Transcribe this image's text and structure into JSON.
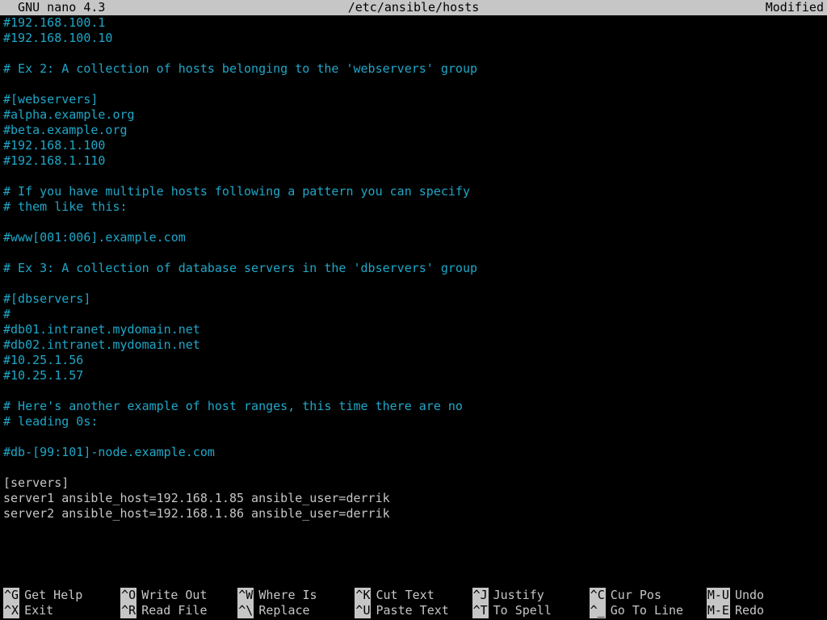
{
  "titlebar": {
    "app": "  GNU nano 4.3",
    "file": "/etc/ansible/hosts",
    "status": "Modified"
  },
  "lines": [
    {
      "type": "comment",
      "text": "#192.168.100.1"
    },
    {
      "type": "comment",
      "text": "#192.168.100.10"
    },
    {
      "type": "comment",
      "text": ""
    },
    {
      "type": "comment",
      "text": "# Ex 2: A collection of hosts belonging to the 'webservers' group"
    },
    {
      "type": "comment",
      "text": ""
    },
    {
      "type": "comment",
      "text": "#[webservers]"
    },
    {
      "type": "comment",
      "text": "#alpha.example.org"
    },
    {
      "type": "comment",
      "text": "#beta.example.org"
    },
    {
      "type": "comment",
      "text": "#192.168.1.100"
    },
    {
      "type": "comment",
      "text": "#192.168.1.110"
    },
    {
      "type": "comment",
      "text": ""
    },
    {
      "type": "comment",
      "text": "# If you have multiple hosts following a pattern you can specify"
    },
    {
      "type": "comment",
      "text": "# them like this:"
    },
    {
      "type": "comment",
      "text": ""
    },
    {
      "type": "comment",
      "text": "#www[001:006].example.com"
    },
    {
      "type": "comment",
      "text": ""
    },
    {
      "type": "comment",
      "text": "# Ex 3: A collection of database servers in the 'dbservers' group"
    },
    {
      "type": "comment",
      "text": ""
    },
    {
      "type": "comment",
      "text": "#[dbservers]"
    },
    {
      "type": "comment",
      "text": "#"
    },
    {
      "type": "comment",
      "text": "#db01.intranet.mydomain.net"
    },
    {
      "type": "comment",
      "text": "#db02.intranet.mydomain.net"
    },
    {
      "type": "comment",
      "text": "#10.25.1.56"
    },
    {
      "type": "comment",
      "text": "#10.25.1.57"
    },
    {
      "type": "comment",
      "text": ""
    },
    {
      "type": "comment",
      "text": "# Here's another example of host ranges, this time there are no"
    },
    {
      "type": "comment",
      "text": "# leading 0s:"
    },
    {
      "type": "comment",
      "text": ""
    },
    {
      "type": "comment",
      "text": "#db-[99:101]-node.example.com"
    },
    {
      "type": "plain",
      "text": ""
    },
    {
      "type": "plain",
      "text": "[servers]"
    },
    {
      "type": "plain",
      "text": "server1 ansible_host=192.168.1.85 ansible_user=derrik"
    },
    {
      "type": "plain",
      "text": "server2 ansible_host=192.168.1.86 ansible_user=derrik"
    }
  ],
  "help": [
    {
      "key": "^G",
      "label": "Get Help"
    },
    {
      "key": "^O",
      "label": "Write Out"
    },
    {
      "key": "^W",
      "label": "Where Is"
    },
    {
      "key": "^K",
      "label": "Cut Text"
    },
    {
      "key": "^J",
      "label": "Justify"
    },
    {
      "key": "^C",
      "label": "Cur Pos"
    },
    {
      "key": "M-U",
      "label": "Undo"
    },
    {
      "key": "^X",
      "label": "Exit"
    },
    {
      "key": "^R",
      "label": "Read File"
    },
    {
      "key": "^\\",
      "label": "Replace"
    },
    {
      "key": "^U",
      "label": "Paste Text"
    },
    {
      "key": "^T",
      "label": "To Spell"
    },
    {
      "key": "^_",
      "label": "Go To Line"
    },
    {
      "key": "M-E",
      "label": "Redo"
    }
  ]
}
